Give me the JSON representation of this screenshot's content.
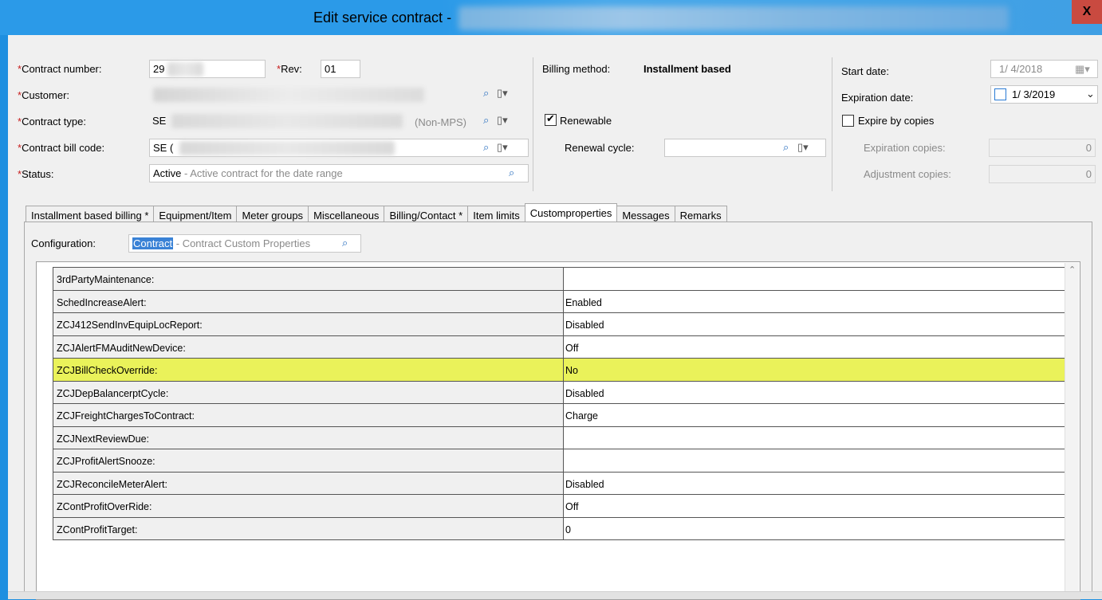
{
  "window": {
    "title": "Edit service contract -",
    "close_label": "X"
  },
  "header": {
    "contract_number_label": "Contract number:",
    "contract_number_value": "29",
    "rev_label": "Rev:",
    "rev_value": "01",
    "customer_label": "Customer:",
    "customer_value": "",
    "contract_type_label": "Contract type:",
    "contract_type_value": "SE",
    "contract_type_suffix": "(Non-MPS)",
    "contract_bill_code_label": "Contract bill code:",
    "contract_bill_code_value": "SE (",
    "status_label": "Status:",
    "status_value": "Active",
    "status_desc": " - Active contract for the date range",
    "required_marker": "*"
  },
  "billing": {
    "billing_method_label": "Billing method:",
    "billing_method_value": "Installment based",
    "renewable_label": "Renewable",
    "renewable_checked": true,
    "renewal_cycle_label": "Renewal cycle:",
    "renewal_cycle_value": ""
  },
  "dates": {
    "start_date_label": "Start date:",
    "start_date_value": "1/ 4/2018",
    "expiration_date_label": "Expiration date:",
    "expiration_date_value": "1/ 3/2019",
    "expire_by_copies_label": "Expire by copies",
    "expire_by_copies_checked": false,
    "expiration_copies_label": "Expiration copies:",
    "expiration_copies_value": "0",
    "adjustment_copies_label": "Adjustment copies:",
    "adjustment_copies_value": "0"
  },
  "tabs": [
    {
      "label": "Installment based billing *"
    },
    {
      "label": "Equipment/Item"
    },
    {
      "label": "Meter groups"
    },
    {
      "label": "Miscellaneous"
    },
    {
      "label": "Billing/Contact *"
    },
    {
      "label": "Item limits"
    },
    {
      "label": "Customproperties"
    },
    {
      "label": "Messages"
    },
    {
      "label": "Remarks"
    }
  ],
  "active_tab": "Customproperties",
  "custom_properties": {
    "configuration_label": "Configuration:",
    "configuration_value": "Contract",
    "configuration_desc": " - Contract Custom Properties",
    "rows": [
      {
        "name": "3rdPartyMaintenance:",
        "value": ""
      },
      {
        "name": "SchedIncreaseAlert:",
        "value": "Enabled"
      },
      {
        "name": "ZCJ412SendInvEquipLocReport:",
        "value": "Disabled"
      },
      {
        "name": "ZCJAlertFMAuditNewDevice:",
        "value": "Off"
      },
      {
        "name": "ZCJBillCheckOverride:",
        "value": "No"
      },
      {
        "name": "ZCJDepBalancerptCycle:",
        "value": "Disabled"
      },
      {
        "name": "ZCJFreightChargesToContract:",
        "value": "Charge"
      },
      {
        "name": "ZCJNextReviewDue:",
        "value": ""
      },
      {
        "name": "ZCJProfitAlertSnooze:",
        "value": ""
      },
      {
        "name": "ZCJReconcileMeterAlert:",
        "value": "Disabled"
      },
      {
        "name": "ZContProfitOverRide:",
        "value": "Off"
      },
      {
        "name": "ZContProfitTarget:",
        "value": "0"
      }
    ],
    "highlighted_row": "ZCJBillCheckOverride:",
    "highlight_color": "#eaf25a"
  },
  "colors": {
    "title_bar": "#2b9ae8",
    "close_button": "#c94a40",
    "required": "#c81e1e"
  }
}
